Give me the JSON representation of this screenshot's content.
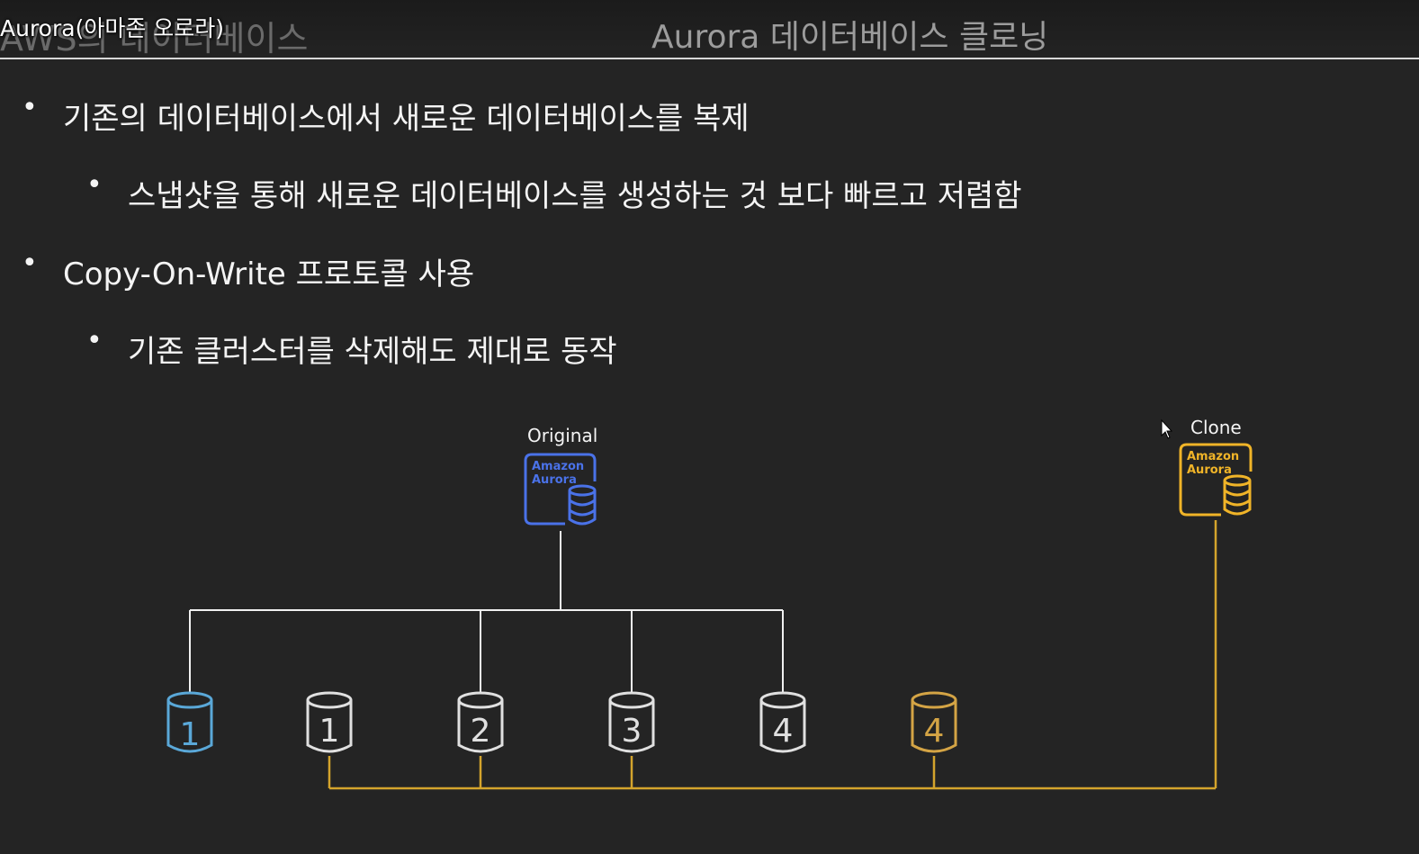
{
  "header": {
    "section_title": "AWS의 데이터베이스",
    "video_title": "Aurora(아마존 오로라)",
    "slide_title": "Aurora 데이터베이스 클로닝"
  },
  "bullets": [
    {
      "level": 1,
      "text": "기존의 데이터베이스에서 새로운 데이터베이스를 복제"
    },
    {
      "level": 2,
      "text": "스냅샷을 통해 새로운 데이터베이스를 생성하는 것 보다 빠르고 저렴함"
    },
    {
      "level": 1,
      "text": "Copy-On-Write 프로토콜 사용"
    },
    {
      "level": 2,
      "text": "기존 클러스터를 삭제해도 제대로 동작"
    }
  ],
  "bullet_glyph": "•",
  "diagram": {
    "original_label": "Original",
    "clone_label": "Clone",
    "aurora_icon_line1": "Amazon",
    "aurora_icon_line2": "Aurora",
    "volumes": [
      "1",
      "1",
      "2",
      "3",
      "4",
      "4"
    ],
    "colors": {
      "original": "#4a72e8",
      "clone": "#f0b428",
      "deleted_volume": "#5aa8d8",
      "shared_volume": "#e0e0e0",
      "clone_volume": "#d4a445",
      "clone_line": "#d4a42c",
      "original_line": "#f0f0f0"
    }
  }
}
